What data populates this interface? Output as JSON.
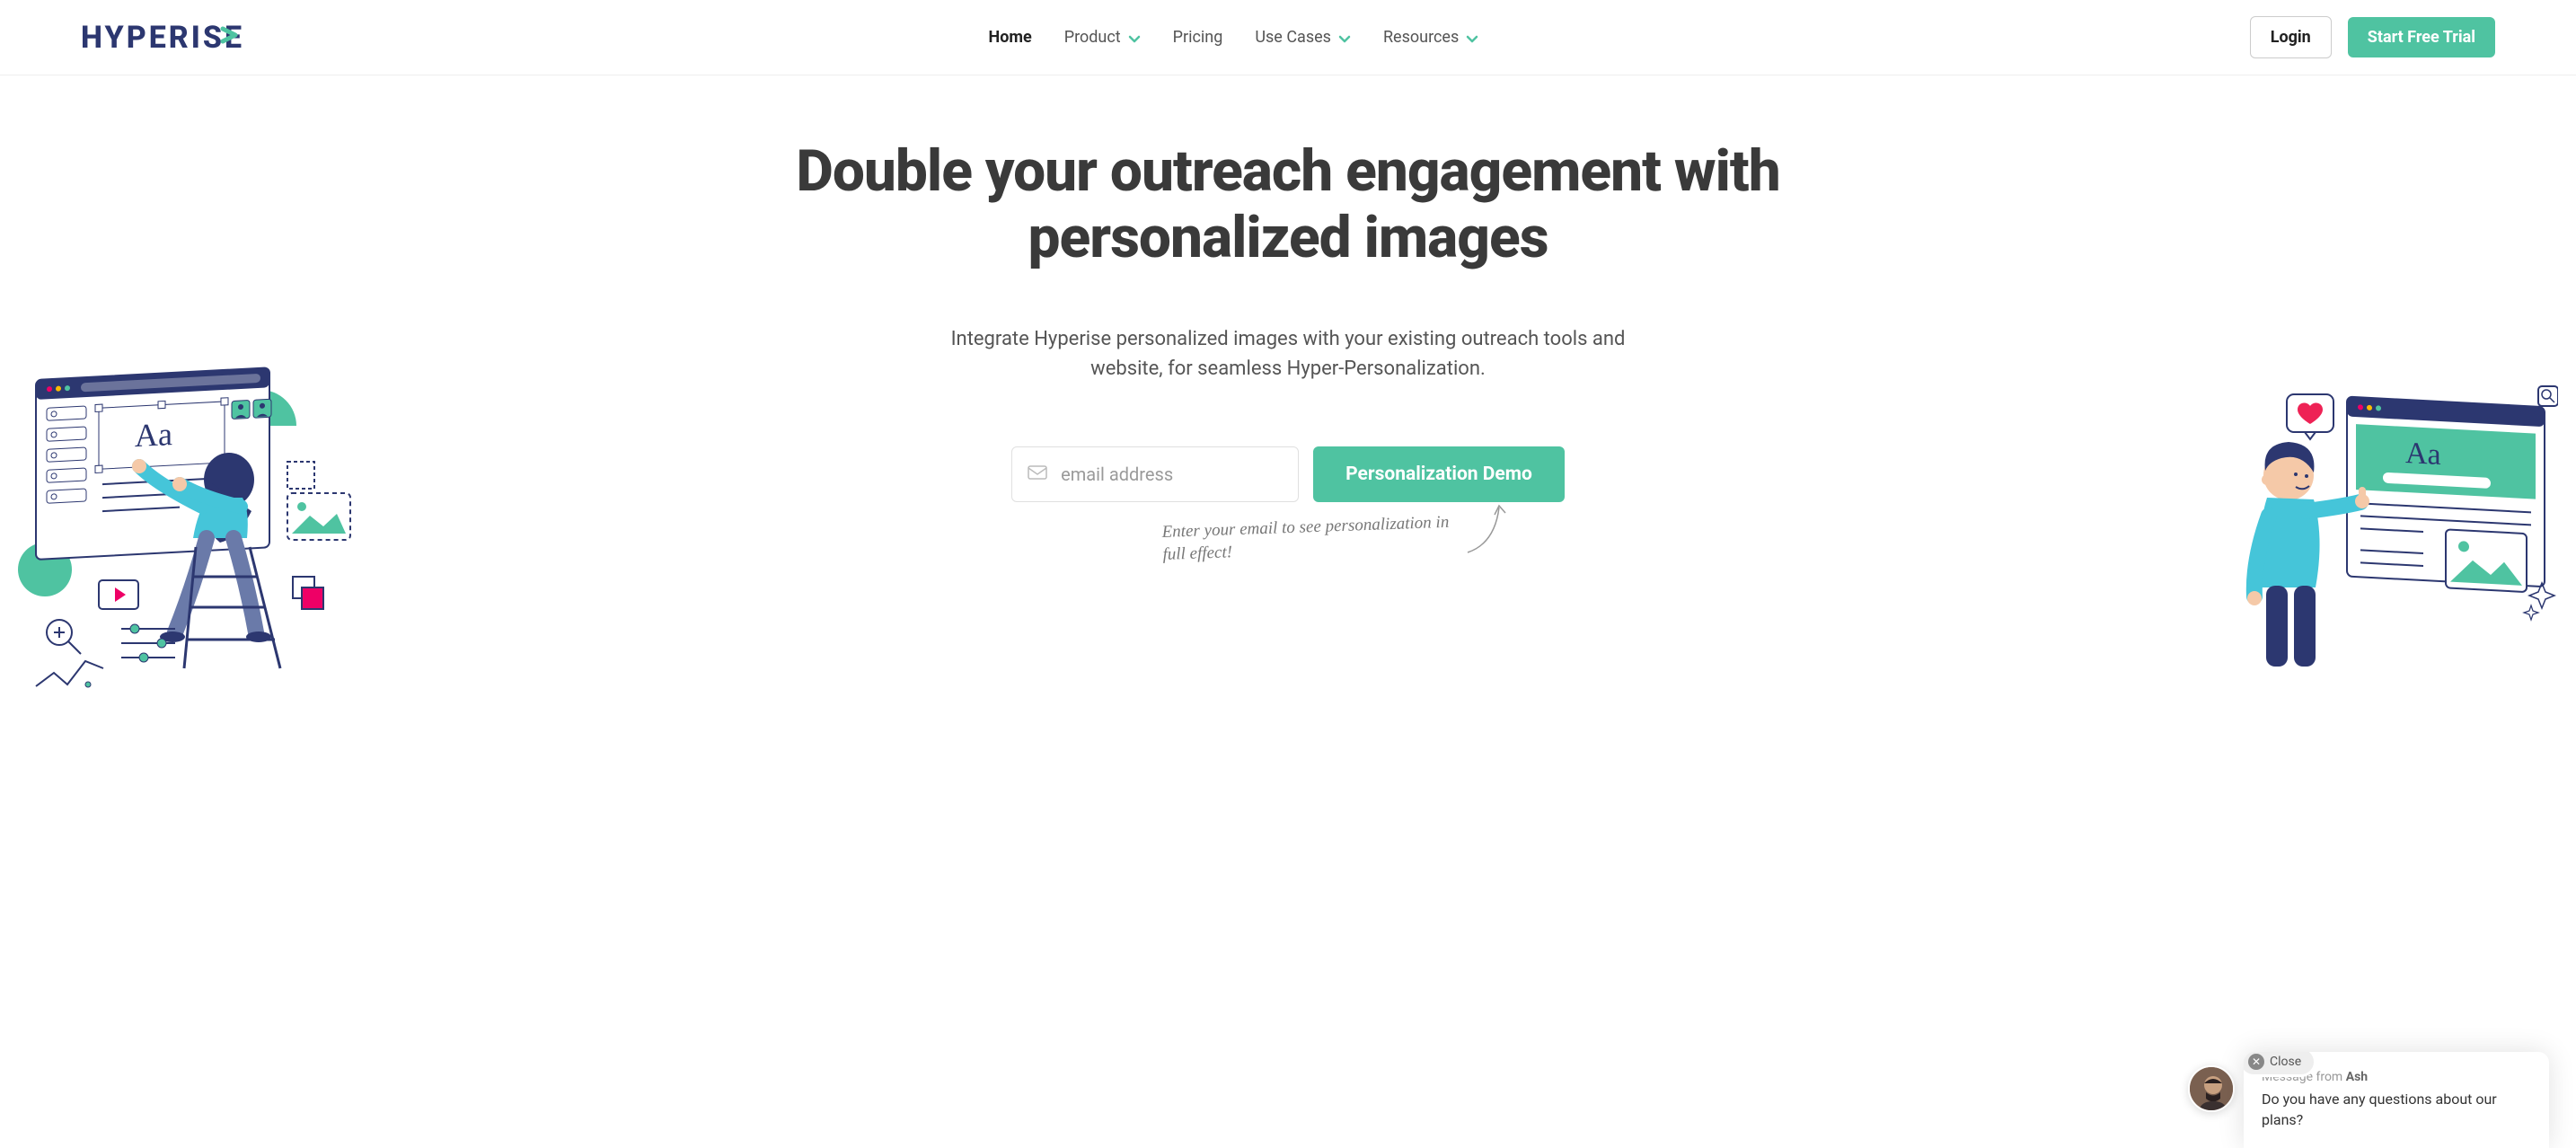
{
  "logo": {
    "text": "HYPERISE"
  },
  "nav": {
    "items": [
      {
        "label": "Home",
        "active": true,
        "dropdown": false
      },
      {
        "label": "Product",
        "active": false,
        "dropdown": true
      },
      {
        "label": "Pricing",
        "active": false,
        "dropdown": false
      },
      {
        "label": "Use Cases",
        "active": false,
        "dropdown": true
      },
      {
        "label": "Resources",
        "active": false,
        "dropdown": true
      }
    ]
  },
  "header": {
    "login_label": "Login",
    "trial_label": "Start Free Trial"
  },
  "hero": {
    "title": "Double your outreach engagement with personalized images",
    "subtitle": "Integrate Hyperise personalized images with your existing outreach tools and website, for seamless Hyper-Personalization.",
    "email_placeholder": "email address",
    "demo_button": "Personalization Demo",
    "handwritten": "Enter your email to see personalization in full effect!"
  },
  "chat": {
    "close_label": "Close",
    "from_prefix": "Message from ",
    "from_name": "Ash",
    "message": "Do you have any questions about our plans?"
  },
  "colors": {
    "brand_navy": "#2c3770",
    "brand_teal": "#4fc3a1"
  }
}
